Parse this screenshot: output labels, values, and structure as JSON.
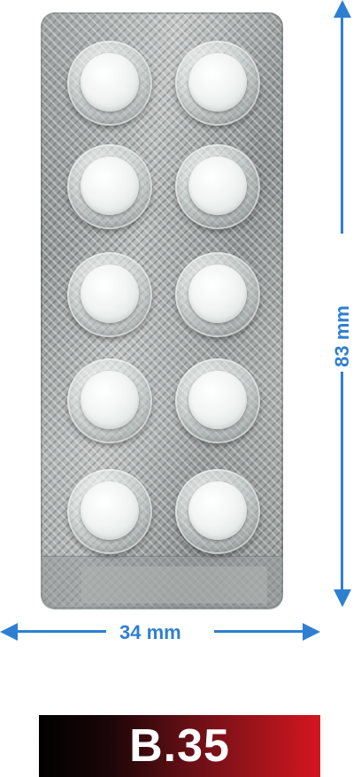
{
  "product": {
    "blister_rows": 5,
    "blister_cols": 2,
    "tablet_count": 10
  },
  "dimensions": {
    "height_label": "83 mm",
    "width_label": "34 mm",
    "color": "#2f7fd0"
  },
  "brand": {
    "code": "B.35",
    "text_color": "#ffffff",
    "gradient": [
      "#000000",
      "#d41620"
    ]
  }
}
